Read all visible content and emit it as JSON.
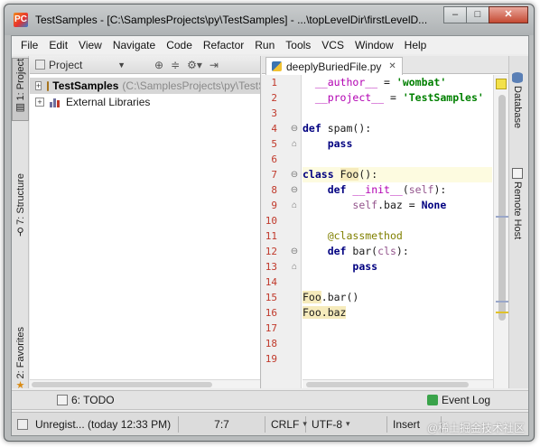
{
  "window": {
    "title": "TestSamples - [C:\\SamplesProjects\\py\\TestSamples] - ...\\topLevelDir\\firstLevelD...",
    "controls": {
      "minimize": "–",
      "maximize": "□",
      "close": "✕"
    }
  },
  "menu": [
    {
      "label": "File"
    },
    {
      "label": "Edit"
    },
    {
      "label": "View"
    },
    {
      "label": "Navigate"
    },
    {
      "label": "Code"
    },
    {
      "label": "Refactor"
    },
    {
      "label": "Run"
    },
    {
      "label": "Tools"
    },
    {
      "label": "VCS"
    },
    {
      "label": "Window"
    },
    {
      "label": "Help"
    }
  ],
  "left_tabs": [
    {
      "label": "1: Project",
      "icon": "project-icon"
    },
    {
      "label": "7: Structure",
      "icon": "structure-icon"
    },
    {
      "label": "2: Favorites",
      "icon": "star-icon"
    }
  ],
  "right_tabs": [
    {
      "label": "Database",
      "icon": "database-icon"
    },
    {
      "label": "Remote Host",
      "icon": "remote-host-icon"
    }
  ],
  "project_panel": {
    "view_selector": "Project",
    "tree": [
      {
        "name": "TestSamples",
        "path": "(C:\\SamplesProjects\\py\\TestSamples)",
        "expander": "+",
        "icon": "folder-icon"
      },
      {
        "name": "External Libraries",
        "path": "",
        "expander": "+",
        "icon": "library-icon"
      }
    ]
  },
  "editor": {
    "tab_label": "deeplyBuriedFile.py",
    "line_numbers": [
      "1",
      "2",
      "3",
      "4",
      "5",
      "6",
      "7",
      "8",
      "9",
      "10",
      "11",
      "12",
      "13",
      "14",
      "15",
      "16",
      "17",
      "18",
      "19"
    ]
  },
  "bottom_bar": {
    "todo_label": "6: TODO",
    "event_log_label": "Event Log"
  },
  "status": {
    "message": "Unregist... (today 12:33 PM)",
    "position": "7:7",
    "line_separator": "CRLF",
    "encoding": "UTF-8",
    "insert_mode": "Insert"
  },
  "watermark": "@稀土掘金技术社区",
  "colors": {
    "line_numbers": "#c0392b",
    "keyword": "#000080",
    "string": "#008000",
    "highlight_line": "#fdfbe0",
    "usage_highlight": "#f6ebbc"
  }
}
